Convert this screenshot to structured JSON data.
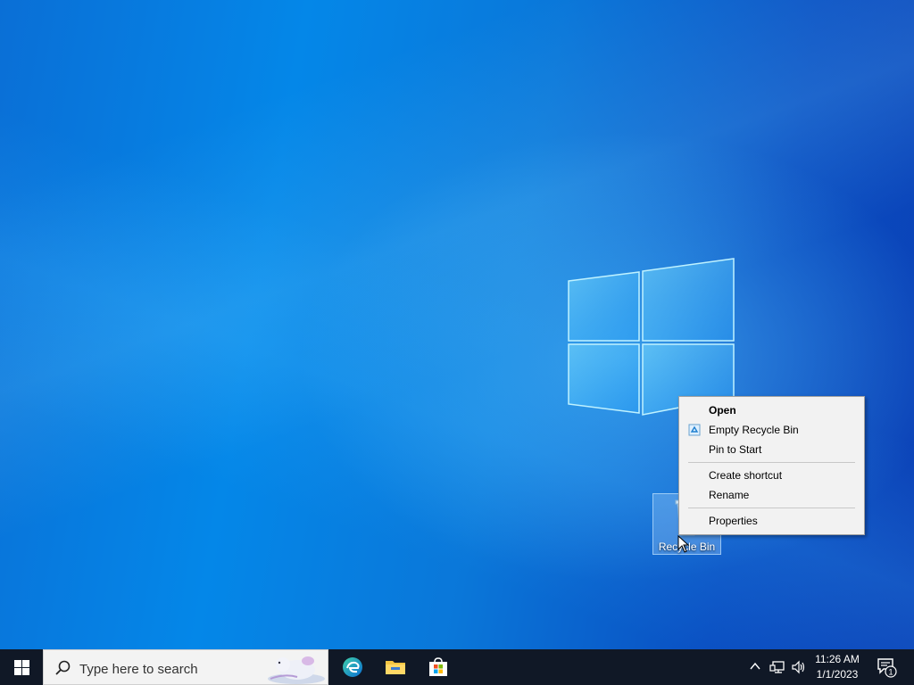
{
  "desktop": {
    "icons": [
      {
        "label": "Recycle Bin",
        "icon": "recycle-bin-icon",
        "selected": true
      }
    ]
  },
  "context_menu": {
    "items": [
      {
        "label": "Open",
        "bold": true
      },
      {
        "label": "Empty Recycle Bin",
        "icon": "recycle-icon"
      },
      {
        "label": "Pin to Start"
      },
      {
        "separator": true
      },
      {
        "label": "Create shortcut"
      },
      {
        "label": "Rename"
      },
      {
        "separator": true
      },
      {
        "label": "Properties"
      }
    ]
  },
  "taskbar": {
    "start_icon": "windows-icon",
    "search": {
      "placeholder": "Type here to search",
      "icon": "search-icon"
    },
    "pinned_apps": [
      {
        "name": "Microsoft Edge",
        "icon": "edge-icon"
      },
      {
        "name": "File Explorer",
        "icon": "folder-icon"
      },
      {
        "name": "Microsoft Store",
        "icon": "store-icon"
      }
    ],
    "tray": {
      "icons": [
        "chevron-up-icon",
        "network-icon",
        "volume-icon"
      ],
      "time": "11:26 AM",
      "date": "1/1/2023",
      "notification_count": "1"
    }
  },
  "colors": {
    "desktop_blue": "#0a77d9",
    "taskbar_bg": "#101826",
    "menu_bg": "#f2f2f2"
  }
}
